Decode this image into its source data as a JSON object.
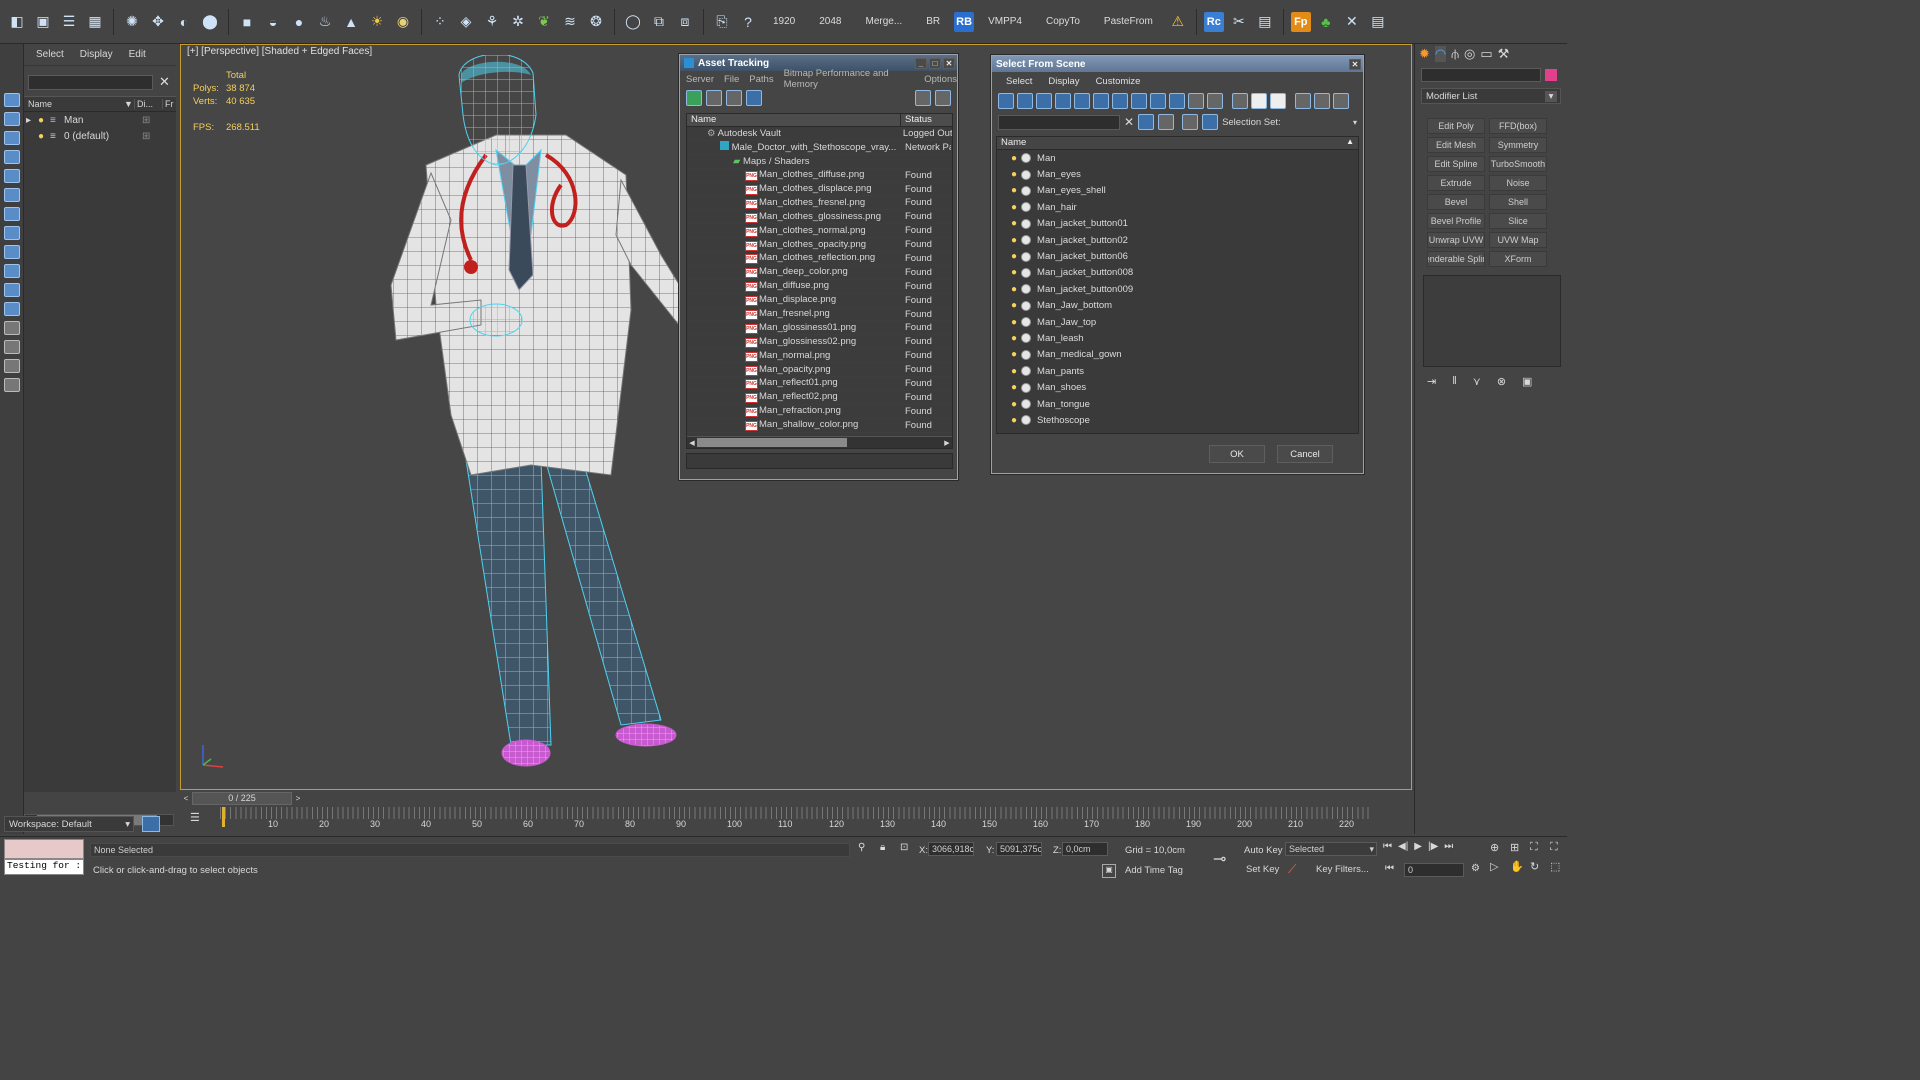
{
  "toolbar": {
    "values": [
      "1920",
      "2048",
      "Merge...",
      "BR",
      "VMPP4",
      "CopyTo",
      "PasteFrom"
    ],
    "badges": {
      "rb": "RB",
      "rc": "Rc",
      "fp": "Fp"
    }
  },
  "explorer": {
    "menu": [
      "Select",
      "Display",
      "Edit"
    ],
    "columns": {
      "name": "Name",
      "display": "Di...",
      "frozen": "Fr"
    },
    "rows": [
      {
        "label": "Man"
      },
      {
        "label": "0 (default)"
      }
    ],
    "workspace": "Workspace: Default"
  },
  "viewport": {
    "label": "[+] [Perspective] [Shaded + Edged Faces]",
    "stats": {
      "total": "Total",
      "polys_label": "Polys:",
      "polys": "38 874",
      "verts_label": "Verts:",
      "verts": "40 635",
      "fps_label": "FPS:",
      "fps": "268.511"
    }
  },
  "asset_tracking": {
    "title": "Asset Tracking",
    "menu": [
      "Server",
      "File",
      "Paths",
      "Bitmap Performance and Memory",
      "Options"
    ],
    "columns": {
      "name": "Name",
      "status": "Status"
    },
    "vault": {
      "name": "Autodesk Vault",
      "status": "Logged Out"
    },
    "file": {
      "name": "Male_Doctor_with_Stethoscope_vray...",
      "status": "Network Pa"
    },
    "maps_folder": "Maps / Shaders",
    "maps": [
      {
        "name": "Man_clothes_diffuse.png",
        "status": "Found"
      },
      {
        "name": "Man_clothes_displace.png",
        "status": "Found"
      },
      {
        "name": "Man_clothes_fresnel.png",
        "status": "Found"
      },
      {
        "name": "Man_clothes_glossiness.png",
        "status": "Found"
      },
      {
        "name": "Man_clothes_normal.png",
        "status": "Found"
      },
      {
        "name": "Man_clothes_opacity.png",
        "status": "Found"
      },
      {
        "name": "Man_clothes_reflection.png",
        "status": "Found"
      },
      {
        "name": "Man_deep_color.png",
        "status": "Found"
      },
      {
        "name": "Man_diffuse.png",
        "status": "Found"
      },
      {
        "name": "Man_displace.png",
        "status": "Found"
      },
      {
        "name": "Man_fresnel.png",
        "status": "Found"
      },
      {
        "name": "Man_glossiness01.png",
        "status": "Found"
      },
      {
        "name": "Man_glossiness02.png",
        "status": "Found"
      },
      {
        "name": "Man_normal.png",
        "status": "Found"
      },
      {
        "name": "Man_opacity.png",
        "status": "Found"
      },
      {
        "name": "Man_reflect01.png",
        "status": "Found"
      },
      {
        "name": "Man_reflect02.png",
        "status": "Found"
      },
      {
        "name": "Man_refraction.png",
        "status": "Found"
      },
      {
        "name": "Man_shallow_color.png",
        "status": "Found"
      }
    ]
  },
  "select_from_scene": {
    "title": "Select From Scene",
    "menu": [
      "Select",
      "Display",
      "Customize"
    ],
    "selection_set_label": "Selection Set:",
    "column": "Name",
    "items": [
      "Man",
      "Man_eyes",
      "Man_eyes_shell",
      "Man_hair",
      "Man_jacket_button01",
      "Man_jacket_button02",
      "Man_jacket_button06",
      "Man_jacket_button008",
      "Man_jacket_button009",
      "Man_Jaw_bottom",
      "Man_Jaw_top",
      "Man_leash",
      "Man_medical_gown",
      "Man_pants",
      "Man_shoes",
      "Man_tongue",
      "Stethoscope"
    ],
    "ok": "OK",
    "cancel": "Cancel"
  },
  "command_panel": {
    "modifier_list": "Modifier List",
    "buttons": [
      "Edit Poly",
      "FFD(box)",
      "Edit Mesh",
      "Symmetry",
      "Edit Spline",
      "TurboSmooth",
      "Extrude",
      "Noise",
      "Bevel",
      "Shell",
      "Bevel Profile",
      "Slice",
      "Unwrap UVW",
      "UVW Map",
      "enderable Splin",
      "XForm"
    ]
  },
  "timeline": {
    "frame": "0 / 225",
    "ticks": [
      "10",
      "20",
      "30",
      "40",
      "50",
      "60",
      "70",
      "80",
      "90",
      "100",
      "110",
      "120",
      "130",
      "140",
      "150",
      "160",
      "170",
      "180",
      "190",
      "200",
      "210",
      "220"
    ]
  },
  "status": {
    "maxscript": "Testing for :",
    "selection": "None Selected",
    "prompt": "Click or click-and-drag to select objects",
    "x_label": "X:",
    "x": "3066,918c",
    "y_label": "Y:",
    "y": "5091,375c",
    "z_label": "Z:",
    "z": "0,0cm",
    "grid": "Grid = 10,0cm",
    "add_time_tag": "Add Time Tag",
    "auto_key": "Auto Key",
    "set_key": "Set Key",
    "selected": "Selected",
    "key_filters": "Key Filters...",
    "frame_field": "0"
  }
}
